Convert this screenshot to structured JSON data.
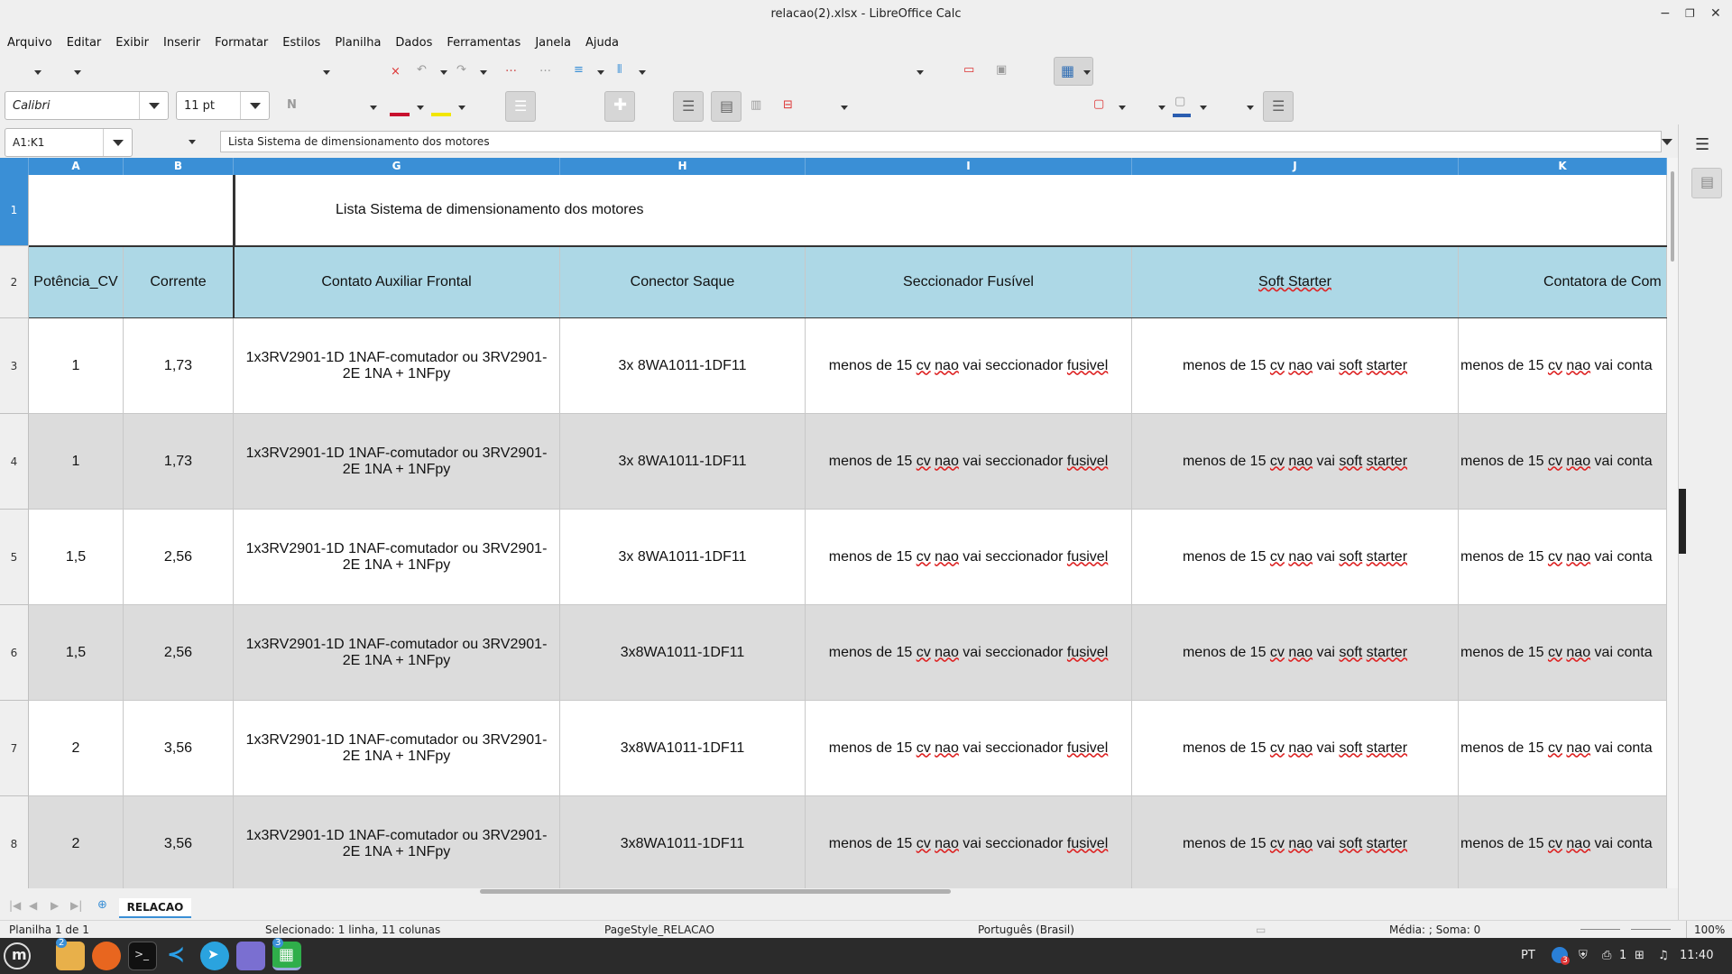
{
  "window": {
    "title": "relacao(2).xlsx - LibreOffice Calc"
  },
  "menu": [
    "Arquivo",
    "Editar",
    "Exibir",
    "Inserir",
    "Formatar",
    "Estilos",
    "Planilha",
    "Dados",
    "Ferramentas",
    "Janela",
    "Ajuda"
  ],
  "toolbar": {
    "font_name": "Calibri",
    "font_size": "11 pt",
    "font_color": "#c8102e",
    "highlight_color": "#f2e600",
    "border_color": "#e0392b"
  },
  "formula": {
    "name_box": "A1:K1",
    "content": "Lista Sistema de dimensionamento dos motores"
  },
  "sheet": {
    "columns": [
      "A",
      "B",
      "G",
      "H",
      "I",
      "J",
      "K"
    ],
    "row_numbers": [
      "1",
      "2",
      "3",
      "4",
      "5",
      "6",
      "7",
      "8"
    ],
    "title": "Lista Sistema de dimensionamento dos motores",
    "headers": [
      "Potência_CV",
      "Corrente",
      "Contato Auxiliar Frontal",
      "Conector Saque",
      "Seccionador Fusível",
      "Soft Starter",
      "Contatora de Com"
    ],
    "rows": [
      {
        "a": "1",
        "b": "1,73",
        "g": "1x3RV2901-1D 1NAF-comutador ou 3RV2901-2E 1NA + 1NFpy",
        "h": "3x 8WA1011-1DF11"
      },
      {
        "a": "1",
        "b": "1,73",
        "g": "1x3RV2901-1D 1NAF-comutador ou 3RV2901-2E 1NA + 1NFpy",
        "h": "3x 8WA1011-1DF11"
      },
      {
        "a": "1,5",
        "b": "2,56",
        "g": "1x3RV2901-1D 1NAF-comutador ou 3RV2901-2E 1NA + 1NFpy",
        "h": "3x 8WA1011-1DF11"
      },
      {
        "a": "1,5",
        "b": "2,56",
        "g": "1x3RV2901-1D 1NAF-comutador ou 3RV2901-2E 1NA + 1NFpy",
        "h": "3x8WA1011-1DF11"
      },
      {
        "a": "2",
        "b": "3,56",
        "g": "1x3RV2901-1D 1NAF-comutador ou 3RV2901-2E 1NA + 1NFpy",
        "h": "3x8WA1011-1DF11"
      },
      {
        "a": "2",
        "b": "3,56",
        "g": "1x3RV2901-1D 1NAF-comutador ou 3RV2901-2E 1NA + 1NFpy",
        "h": "3x8WA1011-1DF11"
      }
    ],
    "i_text": {
      "pre": "menos de 15 ",
      "w1": "cv",
      "sp1": " ",
      "w2": "nao",
      "mid": " vai seccionador ",
      "w3": "fusivel"
    },
    "j_text": {
      "pre": "menos de 15 ",
      "w1": "cv",
      "sp1": " ",
      "w2": "nao",
      "mid": " vai ",
      "w3": "soft",
      "sp2": " ",
      "w4": "starter"
    },
    "k_text": {
      "pre": "menos de 15 ",
      "w1": "cv",
      "sp1": " ",
      "w2": "nao",
      "mid": " vai conta"
    },
    "stripe_color": "#dcdcdc"
  },
  "tabs": {
    "active": "RELACAO"
  },
  "status": {
    "sheet_of": "Planilha 1 de 1",
    "selection": "Selecionado: 1 linha, 11 colunas",
    "page_style": "PageStyle_RELACAO",
    "language": "Português (Brasil)",
    "sum": "Média: ; Soma: 0",
    "zoom": "100%"
  },
  "taskbar": {
    "lang": "PT",
    "clock": "11:40",
    "badge_files": "2",
    "badge_calc": "3",
    "tray_count": "1",
    "notif_count": "3"
  }
}
